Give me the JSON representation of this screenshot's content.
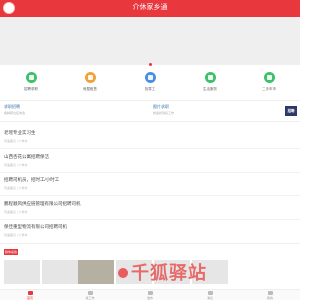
{
  "header": {
    "title": "介休家乡通"
  },
  "nav": {
    "items": [
      {
        "label": "招聘求职",
        "icon": "recruit-icon",
        "color": "#3fc06b"
      },
      {
        "label": "房屋租售",
        "icon": "house-icon",
        "color": "#f2a23b"
      },
      {
        "label": "找零工",
        "icon": "temp-work-icon",
        "color": "#4a90e2"
      },
      {
        "label": "生活服务",
        "icon": "service-icon",
        "color": "#3fc06b"
      },
      {
        "label": "二手车市",
        "icon": "used-car-icon",
        "color": "#3fc06b"
      }
    ]
  },
  "promos": [
    {
      "title": "求职招聘",
      "sub": "各种职位任你选"
    },
    {
      "title": "图片求职",
      "sub": "快速找到好工作"
    }
  ],
  "promo_tag": "招聘",
  "jobs": [
    {
      "title": "老瑶专业实习生",
      "meta": "待遇面议 | 介休市"
    },
    {
      "title": "山西杏花公寓招聘保洁",
      "meta": "待遇面议 | 介休市"
    },
    {
      "title": "招聘司机员，招时工/小时工",
      "meta": "待遇面议 | 介休市"
    },
    {
      "title": "鹏程顺风供应链管理有限公司招聘司机",
      "meta": "待遇面议 | 介休市"
    },
    {
      "title": "保佳重型物流有限公司招聘司机",
      "meta": "待遇面议 | 介休市"
    }
  ],
  "section_tag": "猜你喜欢",
  "watermark": "千狐驿站",
  "tabs": [
    {
      "label": "首页",
      "active": true
    },
    {
      "label": "找工作",
      "active": false
    },
    {
      "label": "发布",
      "active": false
    },
    {
      "label": "消息",
      "active": false
    },
    {
      "label": "我的",
      "active": false
    }
  ],
  "colors": {
    "brand": "#e8383d",
    "link": "#3a6fb0"
  }
}
